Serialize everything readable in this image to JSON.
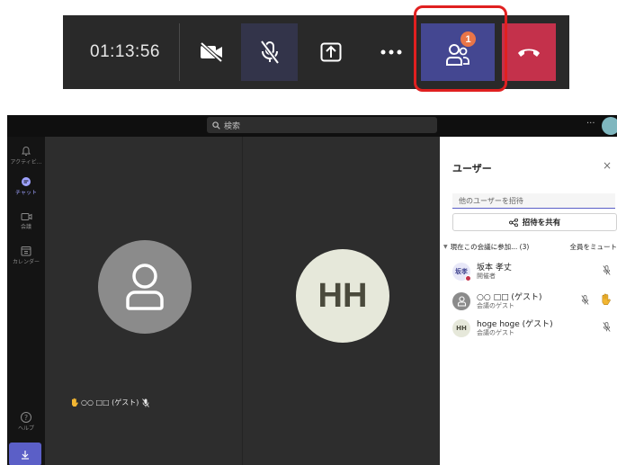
{
  "toolbar": {
    "duration": "01:13:56",
    "participants_badge": "1",
    "buttons": {
      "camera": "camera-off-icon",
      "mic": "mic-off-icon",
      "share": "share-screen-icon",
      "more": "more-icon",
      "people": "people-icon",
      "hangup": "hang-up-icon"
    },
    "colors": {
      "background": "#292929",
      "people_active": "#444791",
      "hangup": "#c4314b",
      "badge": "#e97548",
      "highlight": "#e02020"
    }
  },
  "window": {
    "search_placeholder": "検索",
    "more_dots": "···"
  },
  "rail": {
    "items": [
      {
        "label": "アクティビ...",
        "icon": "bell-icon"
      },
      {
        "label": "チャット",
        "icon": "chat-icon"
      },
      {
        "label": "会議",
        "icon": "video-icon"
      },
      {
        "label": "カレンダー",
        "icon": "calendar-icon"
      }
    ],
    "help": {
      "label": "ヘルプ",
      "icon": "help-icon",
      "glyph": "?"
    },
    "download_icon": "download-icon"
  },
  "stage": {
    "guest_label": "○○ □□ (ゲスト)",
    "host_initials": "HH"
  },
  "panel": {
    "title": "ユーザー",
    "close": "×",
    "invite_placeholder": "他のユーザーを招待",
    "share_invite": "招待を共有",
    "section_title": "現在この会議に参加... (3)",
    "mute_all": "全員をミュート",
    "participants": [
      {
        "name": "坂本 孝丈",
        "role": "開催者",
        "avatar": "坂孝",
        "avatar_color": "#e8e8f8",
        "status_color": "#c4314b"
      },
      {
        "name": "○○ □□ (ゲスト)",
        "role": "会議のゲスト",
        "avatar_icon": "person-icon",
        "avatar_color": "#8b8b8b",
        "hand_raised": true
      },
      {
        "name": "hoge hoge (ゲスト)",
        "role": "会議のゲスト",
        "avatar": "HH",
        "avatar_color": "#e6e8da"
      }
    ]
  }
}
